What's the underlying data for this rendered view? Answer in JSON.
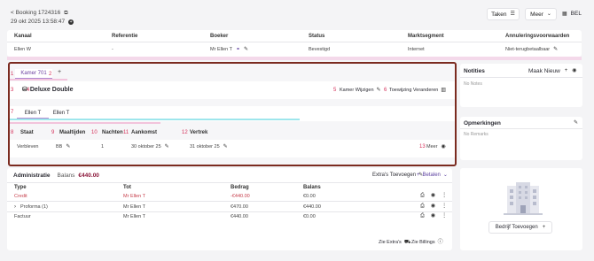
{
  "header": {
    "breadcrumb": "< Booking 1724316",
    "datetime": "29 okt 2025 13:58:47",
    "taken_label": "Taken",
    "meer_label": "Meer",
    "bel_label": "BEL"
  },
  "summary": {
    "columns": [
      "Kanaal",
      "Referentie",
      "Boeker",
      "Status",
      "Marktsegment",
      "Annuleringsvoorwaarden"
    ],
    "values": [
      "Ellen W",
      "-",
      "Mr Ellen T",
      "Bevestigd",
      "Internet",
      "Niet-terugbetaalbaar"
    ]
  },
  "room": {
    "tab_label": "Kamer 701",
    "tab_add": "+",
    "room_type": "Deluxe Double",
    "change_room_label": "Kamer Wijzigen",
    "change_assignment_label": "Toewijzing Veranderen",
    "guests": [
      "Ellen T",
      "Ellen T"
    ],
    "columns": [
      "Staat",
      "Maaltijden",
      "Nachten",
      "Aankomst",
      "Vertrek"
    ],
    "row": {
      "staat": "Verbleven",
      "maaltijden": "BB",
      "nachten": "1",
      "aankomst": "30 oktober 25",
      "vertrek": "31 oktober 25",
      "meer": "Meer"
    },
    "markers": [
      "1",
      "2",
      "3",
      "4",
      "5",
      "6",
      "7",
      "8",
      "9",
      "10",
      "11",
      "12",
      "13"
    ]
  },
  "notities": {
    "title": "Notities",
    "action": "Maak Nieuw",
    "empty": "No Notes"
  },
  "opmerkingen": {
    "title": "Opmerkingen",
    "empty": "No Remarks"
  },
  "administratie": {
    "title": "Administratie",
    "balans_label": "Balans",
    "balans_value": "€440.00",
    "extras_label": "Extra's Toevoegen",
    "betalen_label": "Betalen",
    "columns": [
      "Type",
      "Tot",
      "Bedrag",
      "Balans"
    ],
    "rows": [
      {
        "type": "Credit",
        "tot": "Mr Ellen T",
        "bedrag": "-€440.00",
        "balans": "€0.00"
      },
      {
        "type": "Proforma (1)",
        "tot": "Mr Ellen T",
        "bedrag": "€470.00",
        "balans": "€440.00"
      },
      {
        "type": "Factuur",
        "tot": "Mr Ellen T",
        "bedrag": "€440.00",
        "balans": "€0.00"
      }
    ],
    "zie_extras": "Zie Extra's",
    "zie_billings": "Zie Billings"
  },
  "company": {
    "add_label": "Bedrijf Toevoegen"
  },
  "colors": {
    "accent": "#8a1538",
    "highlight_border": "#7b2b20",
    "credit_red": "#c63d4a"
  }
}
